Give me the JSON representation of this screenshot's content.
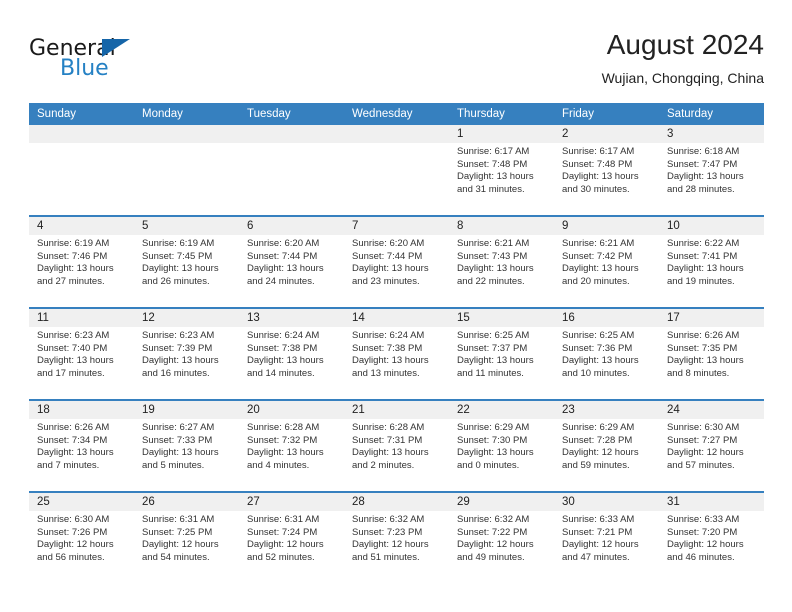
{
  "brand": {
    "name_part1": "General",
    "name_part2": "Blue"
  },
  "header": {
    "title": "August 2024",
    "subtitle": "Wujian, Chongqing, China"
  },
  "colors": {
    "header_blue": "#3680bf",
    "brand_blue": "#2581c4",
    "date_band": "#f0f0f0"
  },
  "weekday_headers": [
    "Sunday",
    "Monday",
    "Tuesday",
    "Wednesday",
    "Thursday",
    "Friday",
    "Saturday"
  ],
  "weeks": [
    [
      {
        "day": "",
        "lines": []
      },
      {
        "day": "",
        "lines": []
      },
      {
        "day": "",
        "lines": []
      },
      {
        "day": "",
        "lines": []
      },
      {
        "day": "1",
        "lines": [
          "Sunrise: 6:17 AM",
          "Sunset: 7:48 PM",
          "Daylight: 13 hours",
          "and 31 minutes."
        ]
      },
      {
        "day": "2",
        "lines": [
          "Sunrise: 6:17 AM",
          "Sunset: 7:48 PM",
          "Daylight: 13 hours",
          "and 30 minutes."
        ]
      },
      {
        "day": "3",
        "lines": [
          "Sunrise: 6:18 AM",
          "Sunset: 7:47 PM",
          "Daylight: 13 hours",
          "and 28 minutes."
        ]
      }
    ],
    [
      {
        "day": "4",
        "lines": [
          "Sunrise: 6:19 AM",
          "Sunset: 7:46 PM",
          "Daylight: 13 hours",
          "and 27 minutes."
        ]
      },
      {
        "day": "5",
        "lines": [
          "Sunrise: 6:19 AM",
          "Sunset: 7:45 PM",
          "Daylight: 13 hours",
          "and 26 minutes."
        ]
      },
      {
        "day": "6",
        "lines": [
          "Sunrise: 6:20 AM",
          "Sunset: 7:44 PM",
          "Daylight: 13 hours",
          "and 24 minutes."
        ]
      },
      {
        "day": "7",
        "lines": [
          "Sunrise: 6:20 AM",
          "Sunset: 7:44 PM",
          "Daylight: 13 hours",
          "and 23 minutes."
        ]
      },
      {
        "day": "8",
        "lines": [
          "Sunrise: 6:21 AM",
          "Sunset: 7:43 PM",
          "Daylight: 13 hours",
          "and 22 minutes."
        ]
      },
      {
        "day": "9",
        "lines": [
          "Sunrise: 6:21 AM",
          "Sunset: 7:42 PM",
          "Daylight: 13 hours",
          "and 20 minutes."
        ]
      },
      {
        "day": "10",
        "lines": [
          "Sunrise: 6:22 AM",
          "Sunset: 7:41 PM",
          "Daylight: 13 hours",
          "and 19 minutes."
        ]
      }
    ],
    [
      {
        "day": "11",
        "lines": [
          "Sunrise: 6:23 AM",
          "Sunset: 7:40 PM",
          "Daylight: 13 hours",
          "and 17 minutes."
        ]
      },
      {
        "day": "12",
        "lines": [
          "Sunrise: 6:23 AM",
          "Sunset: 7:39 PM",
          "Daylight: 13 hours",
          "and 16 minutes."
        ]
      },
      {
        "day": "13",
        "lines": [
          "Sunrise: 6:24 AM",
          "Sunset: 7:38 PM",
          "Daylight: 13 hours",
          "and 14 minutes."
        ]
      },
      {
        "day": "14",
        "lines": [
          "Sunrise: 6:24 AM",
          "Sunset: 7:38 PM",
          "Daylight: 13 hours",
          "and 13 minutes."
        ]
      },
      {
        "day": "15",
        "lines": [
          "Sunrise: 6:25 AM",
          "Sunset: 7:37 PM",
          "Daylight: 13 hours",
          "and 11 minutes."
        ]
      },
      {
        "day": "16",
        "lines": [
          "Sunrise: 6:25 AM",
          "Sunset: 7:36 PM",
          "Daylight: 13 hours",
          "and 10 minutes."
        ]
      },
      {
        "day": "17",
        "lines": [
          "Sunrise: 6:26 AM",
          "Sunset: 7:35 PM",
          "Daylight: 13 hours",
          "and 8 minutes."
        ]
      }
    ],
    [
      {
        "day": "18",
        "lines": [
          "Sunrise: 6:26 AM",
          "Sunset: 7:34 PM",
          "Daylight: 13 hours",
          "and 7 minutes."
        ]
      },
      {
        "day": "19",
        "lines": [
          "Sunrise: 6:27 AM",
          "Sunset: 7:33 PM",
          "Daylight: 13 hours",
          "and 5 minutes."
        ]
      },
      {
        "day": "20",
        "lines": [
          "Sunrise: 6:28 AM",
          "Sunset: 7:32 PM",
          "Daylight: 13 hours",
          "and 4 minutes."
        ]
      },
      {
        "day": "21",
        "lines": [
          "Sunrise: 6:28 AM",
          "Sunset: 7:31 PM",
          "Daylight: 13 hours",
          "and 2 minutes."
        ]
      },
      {
        "day": "22",
        "lines": [
          "Sunrise: 6:29 AM",
          "Sunset: 7:30 PM",
          "Daylight: 13 hours",
          "and 0 minutes."
        ]
      },
      {
        "day": "23",
        "lines": [
          "Sunrise: 6:29 AM",
          "Sunset: 7:28 PM",
          "Daylight: 12 hours",
          "and 59 minutes."
        ]
      },
      {
        "day": "24",
        "lines": [
          "Sunrise: 6:30 AM",
          "Sunset: 7:27 PM",
          "Daylight: 12 hours",
          "and 57 minutes."
        ]
      }
    ],
    [
      {
        "day": "25",
        "lines": [
          "Sunrise: 6:30 AM",
          "Sunset: 7:26 PM",
          "Daylight: 12 hours",
          "and 56 minutes."
        ]
      },
      {
        "day": "26",
        "lines": [
          "Sunrise: 6:31 AM",
          "Sunset: 7:25 PM",
          "Daylight: 12 hours",
          "and 54 minutes."
        ]
      },
      {
        "day": "27",
        "lines": [
          "Sunrise: 6:31 AM",
          "Sunset: 7:24 PM",
          "Daylight: 12 hours",
          "and 52 minutes."
        ]
      },
      {
        "day": "28",
        "lines": [
          "Sunrise: 6:32 AM",
          "Sunset: 7:23 PM",
          "Daylight: 12 hours",
          "and 51 minutes."
        ]
      },
      {
        "day": "29",
        "lines": [
          "Sunrise: 6:32 AM",
          "Sunset: 7:22 PM",
          "Daylight: 12 hours",
          "and 49 minutes."
        ]
      },
      {
        "day": "30",
        "lines": [
          "Sunrise: 6:33 AM",
          "Sunset: 7:21 PM",
          "Daylight: 12 hours",
          "and 47 minutes."
        ]
      },
      {
        "day": "31",
        "lines": [
          "Sunrise: 6:33 AM",
          "Sunset: 7:20 PM",
          "Daylight: 12 hours",
          "and 46 minutes."
        ]
      }
    ]
  ]
}
